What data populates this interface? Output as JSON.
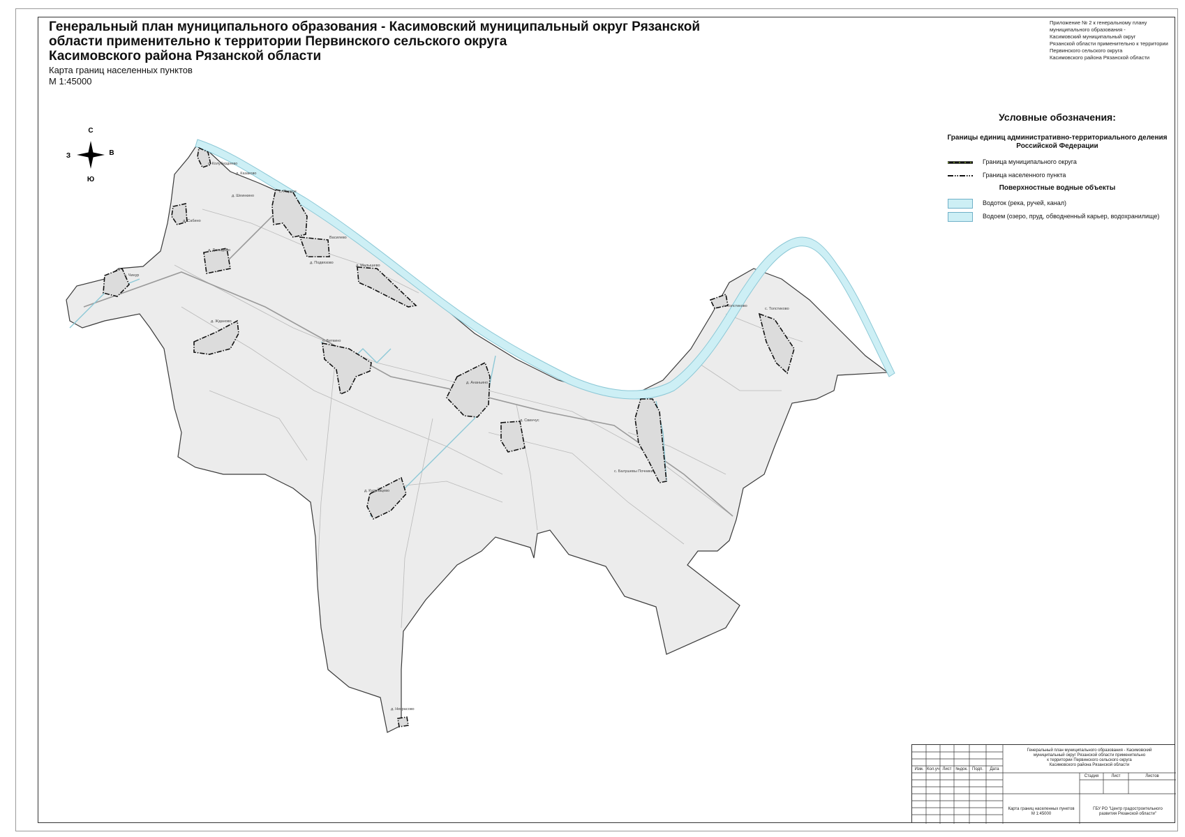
{
  "header": {
    "title_lines": [
      "Генеральный план муниципального образования - Касимовский муниципальный округ Рязанской",
      "области применительно к территории Первинского сельского округа",
      "Касимовского района Рязанской области"
    ],
    "map_name": "Карта границ населенных пунктов",
    "scale": "М 1:45000"
  },
  "annex": [
    "Приложение № 2 к генеральному плану",
    "муниципального образования -",
    "Касимовский муниципальный округ",
    "Рязанской области применительно к территории",
    "Первинского сельского округа",
    "Касимовского района Рязанской области"
  ],
  "compass": {
    "north": "С",
    "south": "Ю",
    "west": "З",
    "east": "В"
  },
  "legend": {
    "title": "Условные обозначения:",
    "section1": "Границы единиц административно-территориального деления Российской Федерации",
    "items1": [
      {
        "label": "Граница муниципального округа",
        "symbol": "municipal-boundary"
      },
      {
        "label": "Граница населенного пункта",
        "symbol": "settlement-boundary"
      }
    ],
    "section2": "Поверхностные водные объекты",
    "items2": [
      {
        "label": "Водоток (река, ручей, канал)",
        "symbol": "watercourse"
      },
      {
        "label": "Водоем (озеро, пруд, обводненный карьер, водохранилище)",
        "symbol": "waterbody"
      }
    ]
  },
  "colors": {
    "territory": "#ececec",
    "river": "#cdeff5",
    "river_edge": "#8cc8d6",
    "boundary": "#2a2a2a"
  },
  "settlements": [
    "с. Колуберднево",
    "д. Казаково",
    "д. Шеинкино",
    "с. Первое",
    "д. Сабино",
    "Василево",
    "д. Давыдово",
    "д. Подвязово",
    "д. Малышево",
    "с. Чинур",
    "д. Жданово",
    "с. Беткино",
    "д. Ананьино",
    "д. Свинчус",
    "д. Кудрявцево",
    "д. Некрасово",
    "с. Толстиково",
    "с. Толстиково",
    "с. Балушевы Почники"
  ],
  "stamp": {
    "columns": [
      "Изм.",
      "Кол.уч",
      "Лист",
      "№док.",
      "Подп.",
      "Дата"
    ],
    "project_lines": [
      "Генеральный план муниципального образования - Касимовский",
      "муниципальный округ Рязанской области применительно",
      "к территории Первинского сельского округа",
      "Касимовского района Рязанской области"
    ],
    "stage_cols": [
      "Стадия",
      "Лист",
      "Листов"
    ],
    "sheet_name": "Карта границ населенных пунктов",
    "sheet_scale": "М 1:45000",
    "org_lines": [
      "ГБУ РО \"Центр градостроительного",
      "развития Рязанской области\""
    ]
  }
}
